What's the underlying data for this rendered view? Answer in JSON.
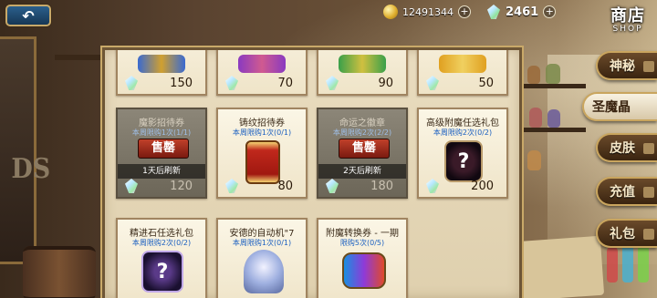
{
  "header": {
    "back_icon": "back-arrow-icon",
    "gold": "12491344",
    "gems": "2461",
    "title_cn": "商店",
    "title_en": "SHOP"
  },
  "background": {
    "wall_letters": "DS"
  },
  "tabs": [
    {
      "label": "神秘",
      "active": false
    },
    {
      "label": "圣魔晶",
      "active": true
    },
    {
      "label": "皮肤",
      "active": false
    },
    {
      "label": "充值",
      "active": false
    },
    {
      "label": "礼包",
      "active": false
    }
  ],
  "items": {
    "row1": [
      {
        "price": "150"
      },
      {
        "price": "70"
      },
      {
        "price": "90"
      },
      {
        "price": "50"
      }
    ],
    "row2": [
      {
        "name": "魔影招待券",
        "limit": "本周限购1次(1/1)",
        "sold": true,
        "sold_label": "售罄",
        "refresh": "1天后刷新",
        "price": "120",
        "icon": "ticket-icon"
      },
      {
        "name": "铸纹招待券",
        "limit": "本周限购1次(0/1)",
        "sold": false,
        "price": "80",
        "icon": "red-scroll-icon"
      },
      {
        "name": "命运之徽章",
        "limit": "本周限购2次(2/2)",
        "sold": true,
        "sold_label": "售罄",
        "refresh": "2天后刷新",
        "price": "180",
        "icon": "badge-icon"
      },
      {
        "name": "高级附魔任选礼包",
        "limit": "本周限购2次(0/2)",
        "sold": false,
        "price": "200",
        "icon": "mystery-scroll-icon"
      }
    ],
    "row3": [
      {
        "name": "精进石任选礼包",
        "limit": "本周限购2次(0/2)",
        "icon": "mystery-pack-icon"
      },
      {
        "name": "安德的自动机\"7",
        "limit": "本周限购1次(0/1)",
        "icon": "robot-icon"
      },
      {
        "name": "附魔转换券 - 一期",
        "limit": "限购5次(0/5)",
        "icon": "blue-scroll-icon"
      }
    ]
  }
}
